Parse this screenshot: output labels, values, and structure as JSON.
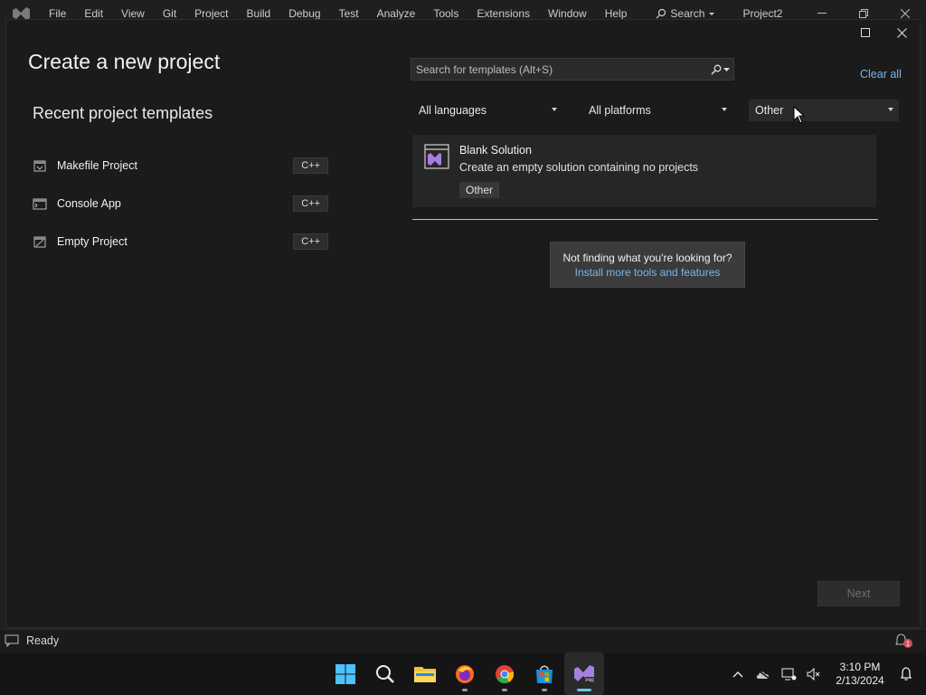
{
  "menubar": {
    "items": [
      "File",
      "Edit",
      "View",
      "Git",
      "Project",
      "Build",
      "Debug",
      "Test",
      "Analyze",
      "Tools",
      "Extensions",
      "Window",
      "Help"
    ],
    "search_label": "Search",
    "project_title": "Project2"
  },
  "dialog": {
    "title": "Create a new project",
    "recent_heading": "Recent project templates",
    "recent_templates": [
      {
        "name": "Makefile Project",
        "language": "C++"
      },
      {
        "name": "Console App",
        "language": "C++"
      },
      {
        "name": "Empty Project",
        "language": "C++"
      }
    ],
    "search_placeholder": "Search for templates (Alt+S)",
    "clear_all": "Clear all",
    "filters": {
      "language": "All languages",
      "platform": "All platforms",
      "project_type": "Other"
    },
    "results": [
      {
        "name": "Blank Solution",
        "description": "Create an empty solution containing no projects",
        "tag": "Other"
      }
    ],
    "not_finding": {
      "question": "Not finding what you're looking for?",
      "link": "Install more tools and features"
    },
    "next_label": "Next"
  },
  "statusbar": {
    "text": "Ready",
    "notification_count": "1"
  },
  "taskbar": {
    "time": "3:10 PM",
    "date": "2/13/2024",
    "apps": [
      "start-icon",
      "search-icon",
      "file-explorer-icon",
      "firefox-icon",
      "chrome-icon",
      "microsoft-store-icon",
      "visual-studio-preview-icon"
    ]
  },
  "colors": {
    "accent_link": "#75b6f0",
    "vs_purple": "#a77fe0",
    "background": "#1b1b1b"
  }
}
